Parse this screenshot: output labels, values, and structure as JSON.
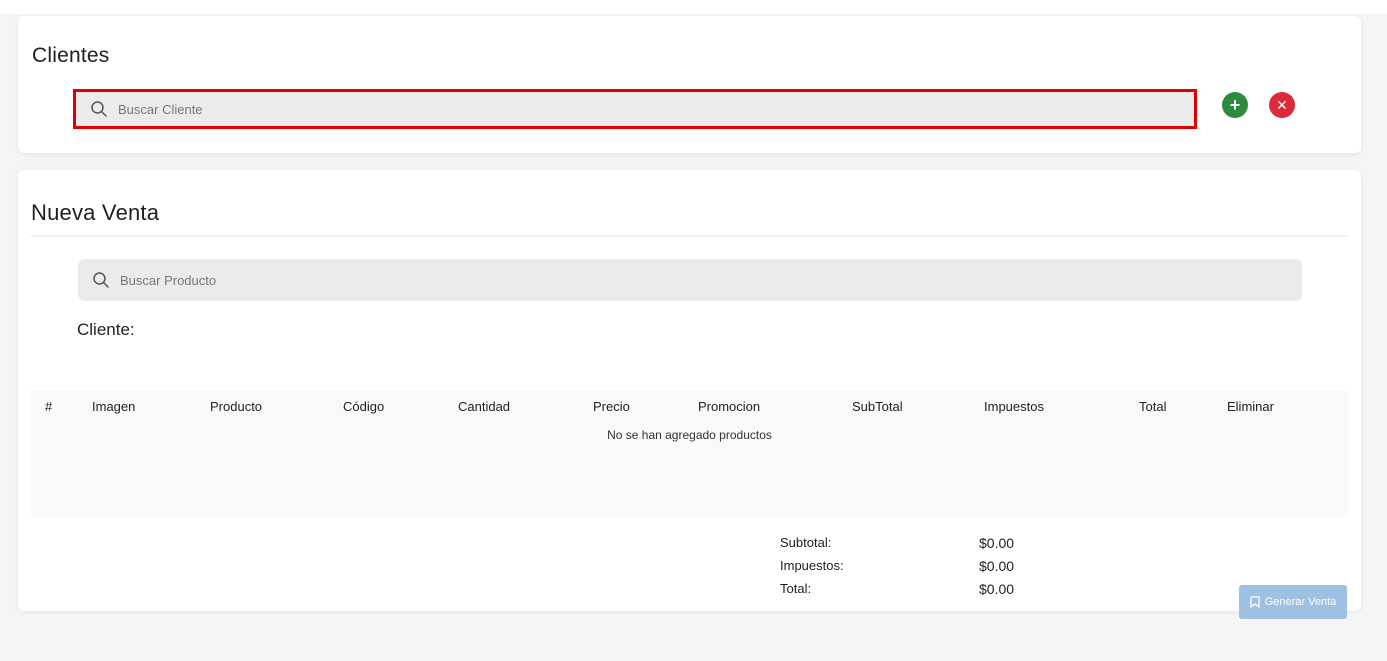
{
  "clientes_card": {
    "title": "Clientes",
    "search_placeholder": "Buscar Cliente",
    "add_button": "+",
    "close_button": "✕"
  },
  "venta_card": {
    "title": "Nueva Venta",
    "search_placeholder": "Buscar Producto",
    "cliente_label": "Cliente:",
    "table": {
      "columns": [
        "#",
        "Imagen",
        "Producto",
        "Código",
        "Cantidad",
        "Precio",
        "Promocion",
        "SubTotal",
        "Impuestos",
        "Total",
        "Eliminar"
      ],
      "empty_message": "No se han agregado productos"
    },
    "totals": {
      "subtotal_label": "Subtotal:",
      "subtotal_value": "$0.00",
      "impuestos_label": "Impuestos:",
      "impuestos_value": "$0.00",
      "total_label": "Total:",
      "total_value": "$0.00"
    },
    "generate_button": "Generar Venta"
  },
  "icons": {
    "search": "search-icon",
    "add": "plus-circle-icon",
    "close": "x-circle-icon",
    "generate": "bookmark-icon"
  },
  "colors": {
    "search_highlight_border": "#e00000",
    "add_button": "#2e8b3d",
    "close_button": "#dc2a3a",
    "generate_button": "#9ec1e3"
  }
}
